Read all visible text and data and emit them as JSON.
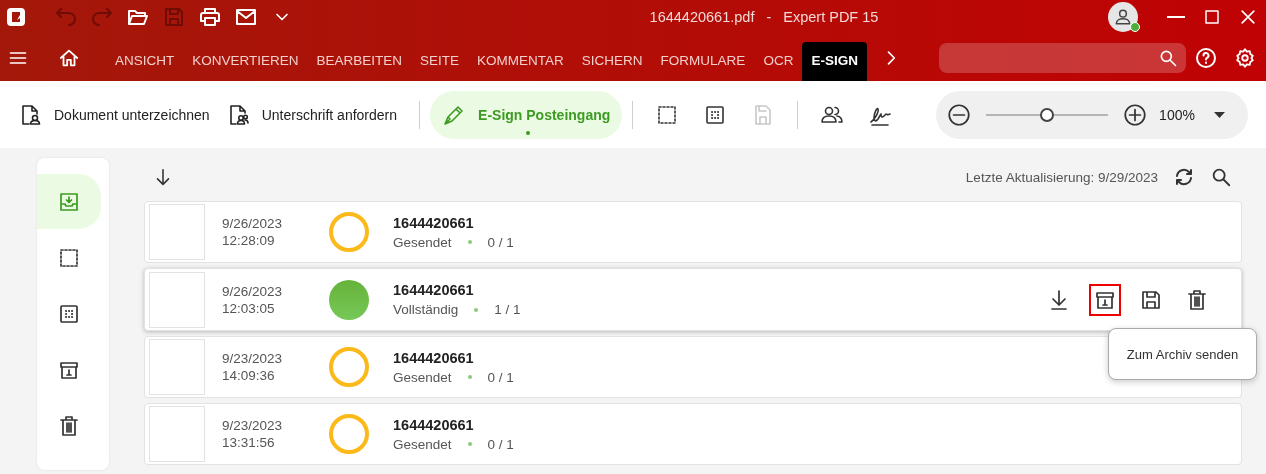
{
  "window": {
    "file": "1644420661.pdf",
    "separator": "-",
    "app": "Expert PDF 15"
  },
  "quick_access": [
    {
      "disabled": true
    },
    {
      "disabled": true
    },
    {
      "disabled": false
    },
    {
      "disabled": true
    },
    {
      "disabled": false
    },
    {
      "disabled": false
    },
    {
      "disabled": false
    }
  ],
  "account": {
    "online": true
  },
  "menu_tabs": [
    {
      "label": "ANSICHT",
      "selected": false
    },
    {
      "label": "KONVERTIEREN",
      "selected": false
    },
    {
      "label": "BEARBEITEN",
      "selected": false
    },
    {
      "label": "SEITE",
      "selected": false
    },
    {
      "label": "KOMMENTAR",
      "selected": false
    },
    {
      "label": "SICHERN",
      "selected": false
    },
    {
      "label": "FORMULARE",
      "selected": false
    },
    {
      "label": "OCR",
      "selected": false
    },
    {
      "label": "E-SIGN",
      "selected": true
    }
  ],
  "toolbar": [
    {
      "kind": "text",
      "label": "Dokument unterzeichnen",
      "selected": false
    },
    {
      "kind": "text",
      "label": "Unterschrift anfordern",
      "selected": false
    },
    {
      "kind": "separator"
    },
    {
      "kind": "text",
      "label": "E-Sign Posteingang",
      "selected": true
    },
    {
      "kind": "separator"
    },
    {
      "kind": "icon",
      "disabled": false
    },
    {
      "kind": "icon",
      "disabled": false
    },
    {
      "kind": "icon",
      "disabled": true
    },
    {
      "kind": "separator"
    },
    {
      "kind": "icon",
      "disabled": false
    },
    {
      "kind": "icon",
      "disabled": false
    }
  ],
  "zoom": {
    "level": 0.5,
    "reading": "100%"
  },
  "sidebar": [
    {
      "selected": true
    },
    {
      "selected": false
    },
    {
      "selected": false
    },
    {
      "selected": false
    },
    {
      "selected": false
    }
  ],
  "inbox": {
    "last_update": "Letzte Aktualisierung: 9/29/2023",
    "rows": [
      {
        "date": "9/26/2023",
        "time": "12:28:09",
        "kind": "pending",
        "name": "1644420661",
        "status": "Gesendet",
        "progress": "0 / 1",
        "hovered": false
      },
      {
        "date": "9/26/2023",
        "time": "12:03:05",
        "kind": "complete",
        "name": "1644420661",
        "status": "Vollständig",
        "progress": "1 / 1",
        "hovered": true
      },
      {
        "date": "9/23/2023",
        "time": "14:09:36",
        "kind": "pending",
        "name": "1644420661",
        "status": "Gesendet",
        "progress": "0 / 1",
        "hovered": false
      },
      {
        "date": "9/23/2023",
        "time": "13:31:56",
        "kind": "pending",
        "name": "1644420661",
        "status": "Gesendet",
        "progress": "0 / 1",
        "hovered": false
      }
    ],
    "row_actions": [
      {
        "highlighted": false
      },
      {
        "highlighted": true
      },
      {
        "highlighted": false
      },
      {
        "highlighted": false
      }
    ],
    "tooltip": "Zum Archiv senden"
  }
}
